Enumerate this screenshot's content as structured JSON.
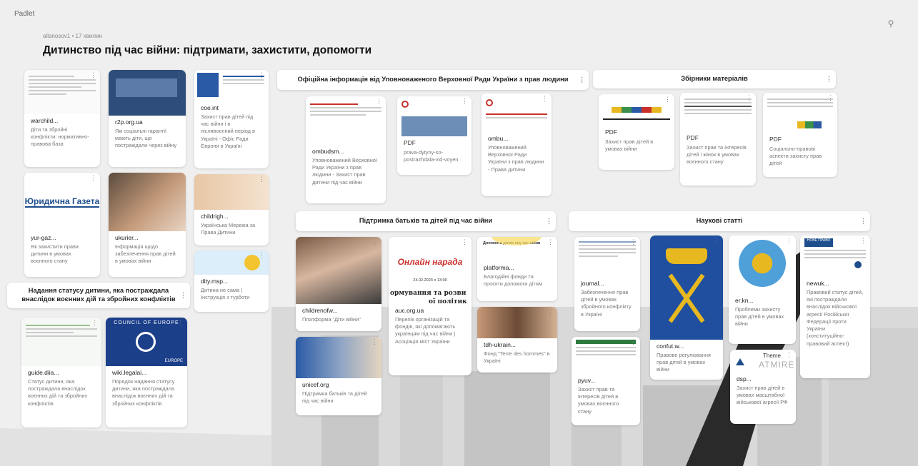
{
  "app": {
    "logo": "Padlet",
    "search_icon": "search-icon"
  },
  "board": {
    "author": "allanosov1 • 17 хвилин",
    "title": "Дитинство під час війни: підтримати, захистити, допомогти"
  },
  "sections": {
    "official": "Офіційна інформація від Уповноваженого Верховної Ради України з прав людини",
    "collections": "Збірники матеріалів",
    "support": "Підтримка батьків та дітей під час війни",
    "scientific": "Наукові статті",
    "status": "Надання статусу дитини, яка постраждала внаслідок воєнних дій та збройних конфліктів"
  },
  "cards": {
    "warchild": {
      "src": "warchild...",
      "desc": "Діти та збройні конфлікти: нормативно-правова база"
    },
    "r2p": {
      "src": "r2p.org.ua",
      "desc": "Які соціальні гарантії мають діти, що постраждали через війну"
    },
    "coe": {
      "src": "coe.int",
      "desc": "Захист прав дітей під час війни і в післявоєнний період в Україні - Офіс Ради Європи в Україні"
    },
    "yurgaz": {
      "src": "yur-gaz...",
      "desc": "Як захистити права дитини в умовах воєнного стану",
      "logo": "Юридична Газета"
    },
    "ukurier": {
      "src": "ukurier...",
      "desc": "Інформація щодо забезпечення прав дітей в умовах війни"
    },
    "childrights": {
      "src": "childrigh...",
      "desc": "Українська Мережа за Права Дитини"
    },
    "dity": {
      "src": "dity.msp...",
      "desc": "Дитина не сама | Інструкція з турботи"
    },
    "guide": {
      "src": "guide.diia...",
      "desc": "Статус дитини, яка постраждала внаслідок воєнних дій та збройних конфліктів"
    },
    "wiki": {
      "src": "wiki.legalai...",
      "desc": "Порядок надання статусу дитини, яка постраждала внаслідок воєнних дій та збройних конфліктів",
      "banner": "COUNCIL OF EUROPE",
      "banner2": "EUROPE"
    },
    "ombuds1": {
      "src": "ombudsm...",
      "desc": "Уповноважений Верховної Ради України з прав людини - Захист прав дитини під час війни"
    },
    "prava": {
      "pdf": "PDF",
      "desc": "prava-dytyny-so-postrazhdala-vid-voyen"
    },
    "ombu2": {
      "src": "ombu...",
      "desc": "Уповноважений Верховної Ради України з прав людини - Права дитини"
    },
    "col1": {
      "pdf": "PDF",
      "desc": "Захист прав дітей в умовах війни"
    },
    "col2": {
      "pdf": "PDF",
      "desc": "Захист прав та інтересів дітей і жінок в умовах воєнного стану"
    },
    "col3": {
      "pdf": "PDF",
      "desc": "Соціально-правові аспекти захисту прав дітей"
    },
    "childrenof": {
      "src": "childrenofw...",
      "desc": "Платформа \"Діти війни\""
    },
    "unicef": {
      "src": "unicef.org",
      "desc": "Підтримка батьків та дітей під час війни"
    },
    "auc": {
      "src": "auc.org.ua",
      "desc": "Перелік організацій та фондів, які допомагають українцям під час війни | Асоціація міст України",
      "t1": "Онлайн нарада",
      "t2": "24.02.2023 о 13:00",
      "t3": "ормування та розви",
      "t4": "ої політик"
    },
    "platforma": {
      "src": "platforma...",
      "desc": "Благодійні фонди та проєкти допомоги дітям",
      "head": "Допомога дітям під час війни"
    },
    "tdh": {
      "src": "tdh-ukrain...",
      "desc": "Фонд \"Terre des hommes\" в Україні"
    },
    "journal": {
      "src": "journal...",
      "desc": "Забезпечення прав дітей в умовах збройного конфлікту в Україні"
    },
    "pyuv": {
      "src": "pyuv...",
      "desc": "Захист прав та інтересів дітей в умовах воєнного стану"
    },
    "confut": {
      "src": "confut.w...",
      "desc": "Правове регулювання прав дітей в умовах війни"
    },
    "erkn": {
      "src": "er.kn...",
      "desc": "Проблеми захисту прав дітей в умовах війни"
    },
    "dsp": {
      "src": "dsp...",
      "desc": "Захист прав дітей в умовах масштабної військової агресії РФ",
      "theme": "Theme",
      "brand": "ATMIRE"
    },
    "newuk": {
      "src": "newuk...",
      "desc": "Правовий статус дітей, які постраждали внаслідок військової агресії Російської Федерації проти України (конституційно-правовий аспект)",
      "head": "НОВЕ ПРАВО"
    }
  },
  "colors": {
    "accent_red": "#c9302c",
    "blue": "#1f4e8c",
    "gold": "#e8b820"
  }
}
